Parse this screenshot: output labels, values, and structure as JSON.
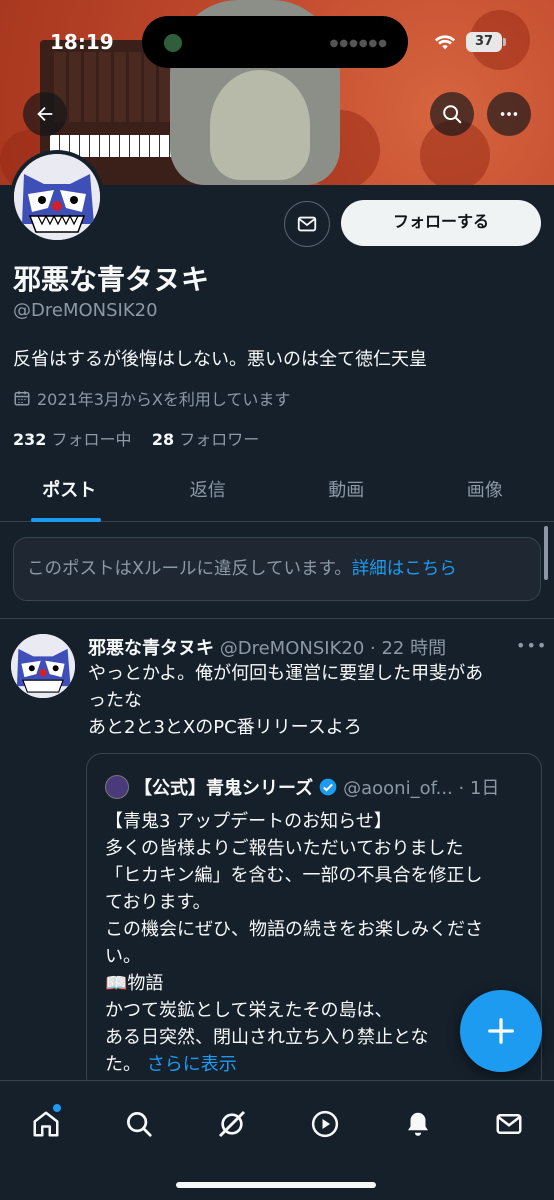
{
  "status": {
    "time": "18:19",
    "battery": "37"
  },
  "profile": {
    "display_name": "邪悪な青タヌキ",
    "handle": "@DreMONSIK20",
    "bio": "反省はするが後悔はしない。悪いのは全て徳仁天皇",
    "joined": "2021年3月からXを利用しています",
    "following_count": "232",
    "following_label": "フォロー中",
    "followers_count": "28",
    "followers_label": "フォロワー",
    "follow_button": "フォローする"
  },
  "tabs": [
    {
      "label": "ポスト",
      "active": true
    },
    {
      "label": "返信",
      "active": false
    },
    {
      "label": "動画",
      "active": false
    },
    {
      "label": "画像",
      "active": false
    }
  ],
  "notice": {
    "text": "このポストはXルールに違反しています。",
    "link": "詳細はこちら"
  },
  "post": {
    "author": "邪悪な青タヌキ",
    "meta": "@DreMONSIK20 · 22 時間",
    "lines": [
      "やっとかよ。俺が何回も運営に要望した甲斐があ",
      "ったな",
      "あと2と3とXのPC番リリースよろ"
    ],
    "quote": {
      "author": "【公式】青鬼シリーズ",
      "meta": "@aooni_of... · 1日",
      "lines": [
        "【青鬼3 アップデートのお知らせ】",
        "多くの皆様よりご報告いただいておりました",
        "「ヒカキン編」を含む、一部の不具合を修正し",
        "ております。",
        "この機会にぜひ、物語の続きをお楽しみくださ",
        "い。",
        "📖物語",
        "かつて炭鉱として栄えたその島は、",
        "ある日突然、閉山され立ち入り禁止とな",
        "た。"
      ],
      "show_more": "さらに表示"
    }
  },
  "colors": {
    "background": "#15202b",
    "accent": "#1d9bf0",
    "muted": "#8b98a5"
  },
  "nav": [
    "home-icon",
    "search-icon",
    "grok-icon",
    "video-icon",
    "notifications-icon",
    "messages-icon"
  ]
}
